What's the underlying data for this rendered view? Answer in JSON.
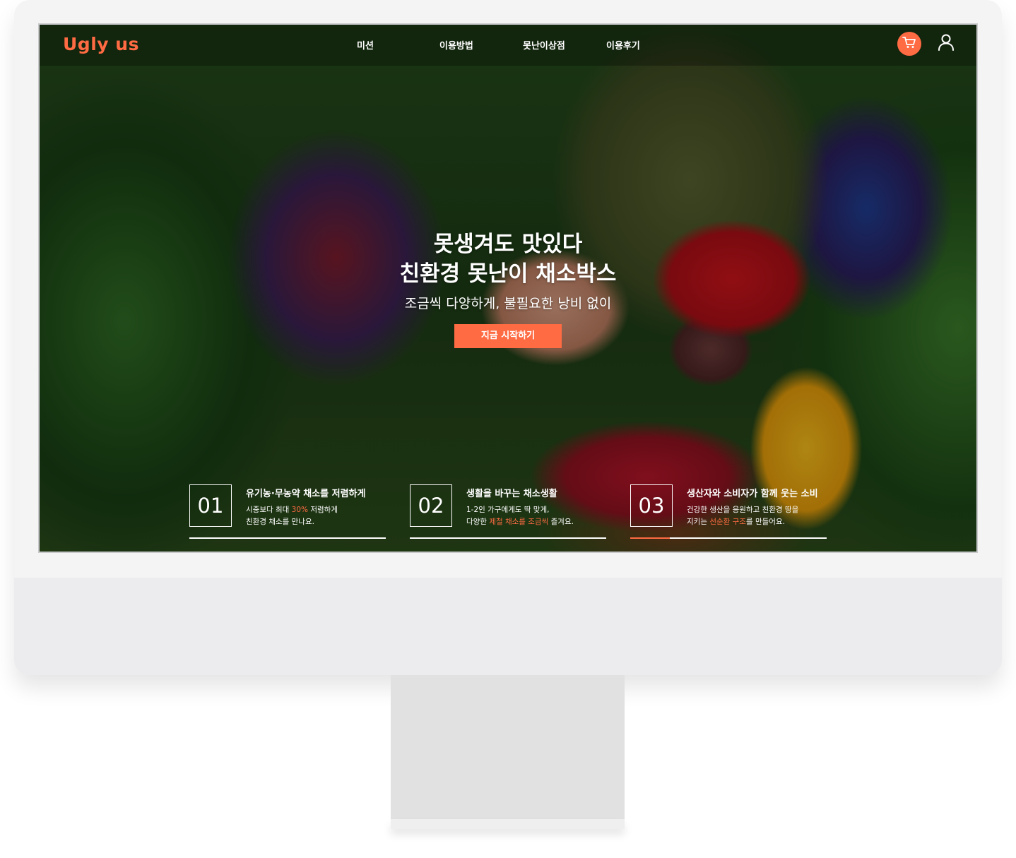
{
  "header": {
    "logo_text": "Ugly us",
    "nav": [
      "미션",
      "이용방법",
      "못난이상점",
      "이용후기"
    ],
    "cart_icon": "cart-icon",
    "user_icon": "user-icon"
  },
  "hero": {
    "title_line1": "못생겨도 맛있다",
    "title_line2": "친환경 못난이 채소박스",
    "subtitle": "조금씩 다양하게, 불필요한 낭비 없이",
    "cta_label": "지금 시작하기"
  },
  "features": [
    {
      "num": "01",
      "title": "유기농·무농약 채소를 저렴하게",
      "desc1_pre": "시중보다 최대 ",
      "desc1_hl": "30%",
      "desc1_post": " 저렴하게",
      "desc2": "친환경 채소를 만나요."
    },
    {
      "num": "02",
      "title": "생활을 바꾸는 채소생활",
      "desc1": "1-2인 가구에게도 딱 맞게,",
      "desc2_pre": "다양한 ",
      "desc2_hl": "제철 채소를 조금씩",
      "desc2_post": " 즐겨요."
    },
    {
      "num": "03",
      "title": "생산자와 소비자가 함께 웃는 소비",
      "desc1": "건강한 생산을 응원하고 친환경 땅을",
      "desc2_pre": "지키는 ",
      "desc2_hl": "선순환 구조",
      "desc2_post": "를 만들어요."
    }
  ],
  "colors": {
    "accent": "#ff6b43",
    "monitor_frame": "#f4f4f5",
    "stand": "#e1e1e2"
  }
}
